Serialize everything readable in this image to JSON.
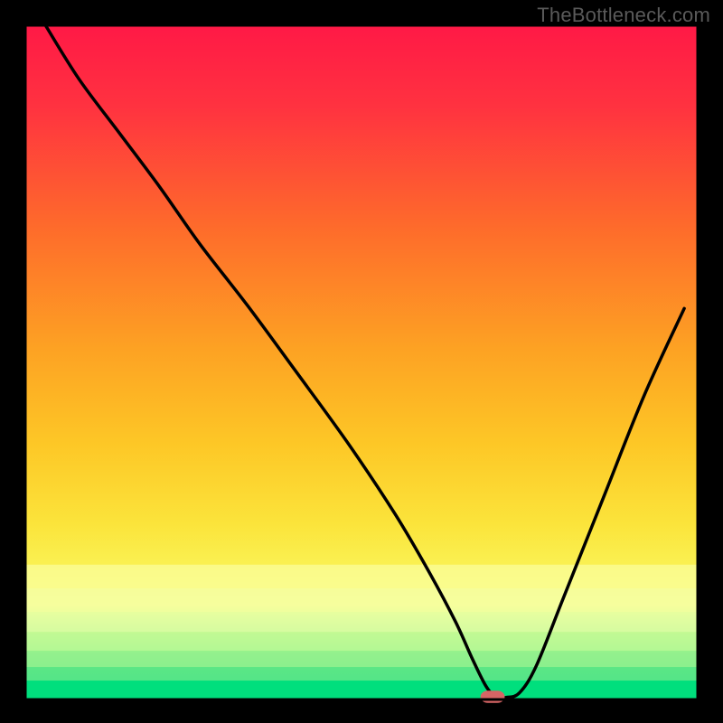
{
  "watermark": "TheBottleneck.com",
  "colors": {
    "background": "#000000",
    "marker_fill": "#d66565",
    "curve_stroke": "#000000",
    "plot_border": "#000000"
  },
  "chart_data": {
    "type": "line",
    "title": "",
    "xlabel": "",
    "ylabel": "",
    "xlim": [
      0,
      100
    ],
    "ylim": [
      0,
      100
    ],
    "grid": false,
    "legend": false,
    "gradient_stops": [
      {
        "pct": 0.0,
        "color": "#ff1946"
      },
      {
        "pct": 0.12,
        "color": "#ff3240"
      },
      {
        "pct": 0.3,
        "color": "#fe6b2b"
      },
      {
        "pct": 0.48,
        "color": "#fda223"
      },
      {
        "pct": 0.62,
        "color": "#fdc726"
      },
      {
        "pct": 0.74,
        "color": "#fbe43b"
      },
      {
        "pct": 0.86,
        "color": "#f9fd68"
      },
      {
        "pct": 0.985,
        "color": "#00e07a"
      },
      {
        "pct": 1.0,
        "color": "#00e07a"
      }
    ],
    "series": [
      {
        "name": "bottleneck-curve",
        "x": [
          3.0,
          8.0,
          14.0,
          20.0,
          26.0,
          33.0,
          40.0,
          48.0,
          55.0,
          60.0,
          64.0,
          66.5,
          68.5,
          70.0,
          71.5,
          73.5,
          76.0,
          80.0,
          86.0,
          92.0,
          98.0
        ],
        "y": [
          100.0,
          92.0,
          84.0,
          76.0,
          67.5,
          58.5,
          49.0,
          38.0,
          27.5,
          19.0,
          11.5,
          6.0,
          2.0,
          0.3,
          0.3,
          1.0,
          5.0,
          15.0,
          30.0,
          45.0,
          58.0
        ]
      }
    ],
    "flat_bottom": {
      "x_start": 65.0,
      "x_end": 72.5,
      "y": 0.3
    },
    "marker": {
      "x": 69.5,
      "y": 0.0,
      "rx": 1.8,
      "ry": 0.9
    }
  }
}
